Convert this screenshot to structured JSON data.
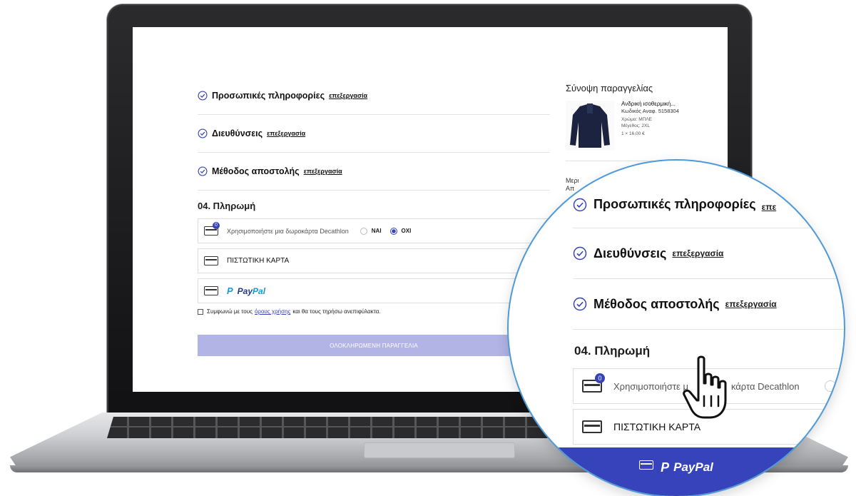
{
  "checkout": {
    "steps": [
      {
        "title": "Προσωπικές πληροφορίες",
        "edit": "επεξεργασία"
      },
      {
        "title": "Διευθύνσεις",
        "edit": "επεξεργασία"
      },
      {
        "title": "Μέθοδος αποστολής",
        "edit": "επεξεργασία"
      }
    ],
    "payment_title": "04. Πληρωμή",
    "gift_card": {
      "badge": "0",
      "text": "Χρησιμοποιήστε μια δωροκάρτα Decathlon",
      "yes": "ΝΑΙ",
      "no": "ΟΧΙ",
      "selected": "ΟΧΙ"
    },
    "credit_card": "ΠΙΣΤΩΤΙΚΗ ΚΑΡΤΑ",
    "paypal": {
      "pay": "Pay",
      "pal": "Pal"
    },
    "terms": {
      "before": "Συμφωνώ με τους",
      "link": "όρους χρήσης",
      "after": "και θα τους τηρήσω ανεπιφύλακτα."
    },
    "order_button": "ΟΛΟΚΛΗΡΩΜΕΝΗ ΠΑΡΑΓΓΕΛΙΑ"
  },
  "summary": {
    "title": "Σύνοψη παραγγελίας",
    "product": {
      "name": "Ανδρική ισοθερμική...",
      "ref": "Κωδικός Αναφ. 5158304",
      "color": "Χρώμα: ΜΠΛΕ",
      "size": "Μέγεθος: 2XL",
      "qty_price": "1 × 16,00 €"
    },
    "partial_line1": "Μερι",
    "partial_line2": "Απ"
  },
  "zoom": {
    "steps": [
      {
        "title": "Προσωπικές πληροφορίες",
        "edit": "επε"
      },
      {
        "title": "Διευθύνσεις",
        "edit": "επεξεργασία"
      },
      {
        "title": "Μέθοδος αποστολής",
        "edit": "επεξεργασία"
      }
    ],
    "payment_title": "04. Πληρωμή",
    "gift_text": "Χρησιμοποιήστε μ",
    "gift_text_after": "κάρτα Decathlon",
    "badge": "0",
    "credit_card": "ΠΙΣΤΩΤΙΚΗ ΚΑΡΤΑ",
    "paypal": "PayPal",
    "paypal_mark": "P"
  },
  "colors": {
    "accent": "#3643ba",
    "button_disabled": "#b1b4e5",
    "paypal_dark": "#253b80",
    "paypal_light": "#179bd7",
    "zoom_ring": "#4f9ad8"
  }
}
